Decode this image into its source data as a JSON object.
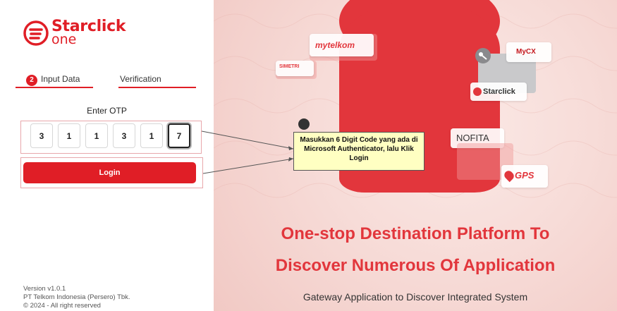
{
  "brand": {
    "name_line1": "Starclick",
    "name_line2": "one",
    "primary_color": "#e01e26"
  },
  "steps": {
    "active_number": "2",
    "step1_label": "Input Data",
    "step2_label": "Verification"
  },
  "otp": {
    "title": "Enter OTP",
    "digits": [
      "3",
      "1",
      "1",
      "3",
      "1",
      "7"
    ]
  },
  "login": {
    "label": "Login"
  },
  "footer": {
    "version": "Version v1.0.1",
    "company": "PT Telkom Indonesia (Persero) Tbk.",
    "copyright": "© 2024 - All right reserved"
  },
  "apps": {
    "mytelkom": "mytelkom",
    "simetri": "SIMETRI",
    "mycx": "MyCX",
    "starclick": "Starclick",
    "nofita": "NOFITA",
    "gps": "GPS"
  },
  "hero": {
    "headline_line1": "One-stop Destination Platform To",
    "headline_line2": "Discover Numerous Of Application",
    "subheadline": "Gateway Application to Discover Integrated System"
  },
  "callout": {
    "text": "Masukkan 6 Digit Code yang ada di Microsoft Authenticator, lalu Klik Login"
  }
}
